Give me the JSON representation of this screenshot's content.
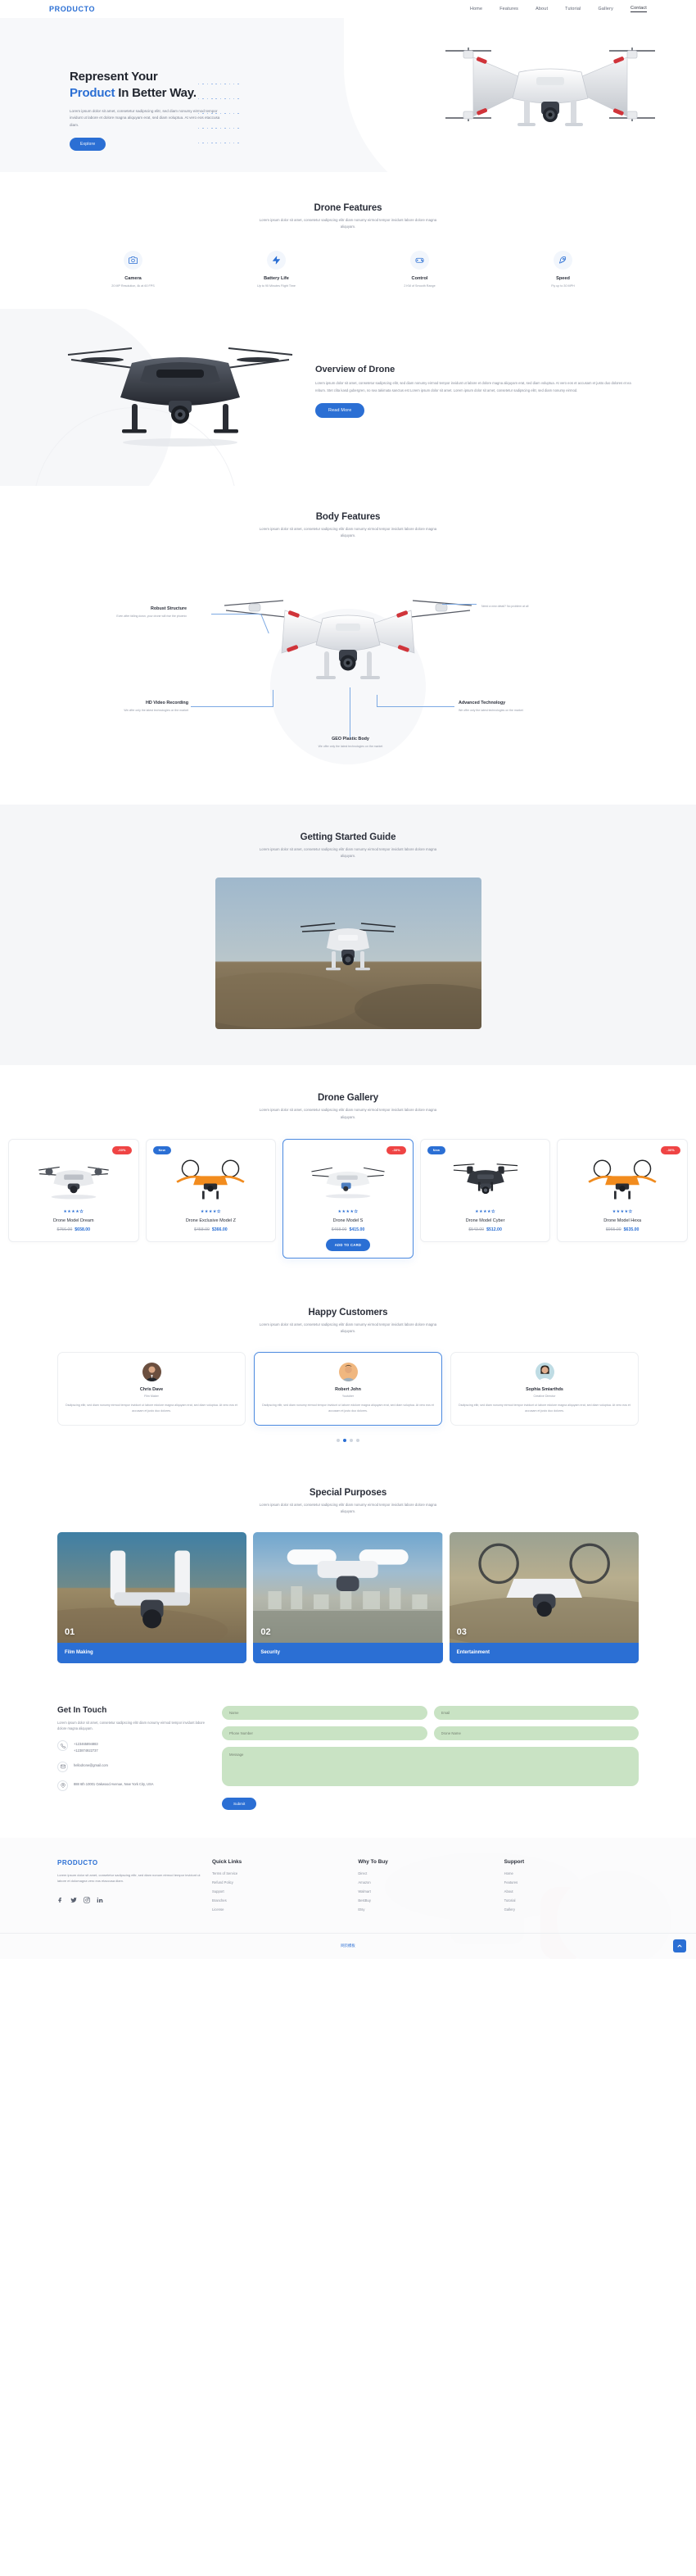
{
  "nav": {
    "brand": "PRODUCTO",
    "links": [
      {
        "label": "Home",
        "active": false
      },
      {
        "label": "Features",
        "active": false
      },
      {
        "label": "About",
        "active": false
      },
      {
        "label": "Tutorial",
        "active": false
      },
      {
        "label": "Gallery",
        "active": false
      },
      {
        "label": "Contact",
        "active": true
      }
    ]
  },
  "hero": {
    "title_line1": "Represent Your",
    "title_accent": "Product",
    "title_rest": " In Better Way.",
    "paragraph": "Lorem ipsum dolor sit amet, consetetur sadipscing elitr, sed diam nonumy eirmod tempor invidunt ut labore et dolore magna aliquyam erat, sed diam voluptua. At vero eos etaccusa diam.",
    "cta": "Explore"
  },
  "features": {
    "title": "Drone Features",
    "subtitle": "Lorem ipsum dolor sit amet, consetetur sadipscing elitr diam nonumy eirmod tempor invidunt labore dolore magna aliquyam.",
    "items": [
      {
        "icon": "camera-icon",
        "title": "Camera",
        "desc": "20 MP Resolution, 4k at 60 FPS"
      },
      {
        "icon": "battery-bolt-icon",
        "title": "Battery Life",
        "desc": "Up to 90 Minutes Flight Time"
      },
      {
        "icon": "gamepad-icon",
        "title": "Control",
        "desc": "2 KM of Smooth Range"
      },
      {
        "icon": "rocket-icon",
        "title": "Speed",
        "desc": "Fly up to 30 MPH"
      }
    ]
  },
  "overview": {
    "title": "Overview of Drone",
    "paragraph": "Lorem ipsum dolor sit amet, consetetur sadipscing elitr, sed diam nonumy eirmod tempor invidunt ut labore et dolore magna aliquyam erat, sed diam voluptua. At vero eos et accusam et justo duo dolores et ea rebum. Stet clita kasd gubergren, no sea takimata sanctus est Lorem ipsum dolor sit amet. Lorem ipsum dolor sit amet, consetetur sadipscing elitr, sed diam nonumy eirmod.",
    "cta": "Read More"
  },
  "body_features": {
    "title": "Body Features",
    "subtitle": "Lorem ipsum dolor sit amet, consetetur sadipscing elitr diam nonumy eirmod tempor invidunt labore dolore magna aliquyam.",
    "annotations": [
      {
        "title": "Robust Structure",
        "desc": "Even after falling down, your drone will rise the phoenix"
      },
      {
        "title": "",
        "desc": "Need a new detail? No problem at all"
      },
      {
        "title": "HD Video Recording",
        "desc": "Get the drone with a spectacular 4k camera"
      },
      {
        "title": "GEO Plastic Body",
        "desc": "We offer only the latest technologies on the market"
      },
      {
        "title": "Advanced Technology",
        "desc": "We offer only the latest technologies on the market"
      }
    ]
  },
  "guide": {
    "title": "Getting Started Guide",
    "subtitle": "Lorem ipsum dolor sit amet, consetetur sadipscing elitr diam nonumy eirmod tempor invidunt labore dolore magna aliquyam."
  },
  "gallery": {
    "title": "Drone Gallery",
    "subtitle": "Lorem ipsum dolor sit amet, consetetur sadipscing elitr diam nonumy eirmod tempor invidunt labore dolore magna aliquyam.",
    "add_to_cart": "ADD TO CARD",
    "products": [
      {
        "name": "Drone Model Dream",
        "old_price": "$756.00",
        "new_price": "$658.00",
        "badge": "-30%",
        "badge_type": "sale",
        "rating": 4,
        "active": false,
        "color": "white"
      },
      {
        "name": "Drone Exclusive Model Z",
        "old_price": "$458.00",
        "new_price": "$366.00",
        "badge": "New",
        "badge_type": "new",
        "rating": 4,
        "active": false,
        "color": "orange"
      },
      {
        "name": "Drone Model S",
        "old_price": "$458.00",
        "new_price": "$415.00",
        "badge": "-30%",
        "badge_type": "sale",
        "rating": 4,
        "active": true,
        "color": "white"
      },
      {
        "name": "Drone Model Cyber",
        "old_price": "$543.00",
        "new_price": "$512.00",
        "badge": "New",
        "badge_type": "new",
        "rating": 4,
        "active": false,
        "color": "black"
      },
      {
        "name": "Drone Model Hexa",
        "old_price": "$965.00",
        "new_price": "$635.00",
        "badge": "-30%",
        "badge_type": "sale",
        "rating": 4,
        "active": false,
        "color": "orange"
      }
    ]
  },
  "testimonials": {
    "title": "Happy Customers",
    "subtitle": "Lorem ipsum dolor sit amet, consetetur sadipscing elitr diam nonumy eirmod tempor invidunt labore dolore magna aliquyam.",
    "items": [
      {
        "name": "Chris Dave",
        "role": "Film Maker",
        "quote": "Dsdipscing elitr, sed diam nonumy eirmod tempor invidunt ut labore edolore magna aliquyam erat, sed diam voluptua. At vero eos et accusam et justo duo dolores.",
        "active": false
      },
      {
        "name": "Robert John",
        "role": "Youtuber",
        "quote": "Dsdipscing elitr, sed diam nonumy eirmod tempor invidunt ut labore edolore magna aliquyam erat, sed diam voluptua. At vero eos et accusam et justo duo dolores.",
        "active": true
      },
      {
        "name": "Sophia Smiarthds",
        "role": "Creative Director",
        "quote": "Dsdipscing elitr, sed diam nonumy eirmod tempor invidunt ut labore edolore magna aliquyam erat, sed diam voluptua. At vero eos et accusam et justo duo dolores.",
        "active": false
      }
    ],
    "dots": [
      false,
      true,
      false,
      false
    ]
  },
  "purposes": {
    "title": "Special Purposes",
    "subtitle": "Lorem ipsum dolor sit amet, consetetur sadipscing elitr diam nonumy eirmod tempor invidunt labore dolore magna aliquyam.",
    "items": [
      {
        "number": "01",
        "label": "Film Making"
      },
      {
        "number": "02",
        "label": "Security"
      },
      {
        "number": "03",
        "label": "Entertainment"
      }
    ]
  },
  "contact": {
    "title": "Get In Touch",
    "paragraph": "Lorem ipsum dolor sit amet, consetetur sadipscing elitr diam nonumy eirmod tempor invidunt labore dolore magna aliquyam.",
    "phone_line1": "+123465894883",
    "phone_line2": "+123874922737",
    "email": "hellodrone@gmail.com",
    "address": "888 6th 10001 Oakwood Avenue, New York City, USA",
    "fields": {
      "name": "Name",
      "email": "Email",
      "phone": "Phone Number",
      "drone": "Drone Name",
      "message": "Message"
    },
    "submit": "Submit"
  },
  "footer": {
    "brand": "PRODUCTO",
    "about": "Lorem ipsum dolor sit amet, consetetur sadipscing elitr, sed diam nonum eirmod tempor invidunt ut labore et dolomagna vero eos etaccusa diam.",
    "socials": [
      "facebook-icon",
      "twitter-icon",
      "instagram-icon",
      "linkedin-icon"
    ],
    "columns": [
      {
        "title": "Quick Links",
        "links": [
          "Terms of Service",
          "Refund Policy",
          "Support",
          "Branches",
          "License"
        ]
      },
      {
        "title": "Why To Buy",
        "links": [
          "Direct",
          "Amazon",
          "Walmart",
          "BestBuy",
          "Etsy"
        ]
      },
      {
        "title": "Support",
        "links": [
          "Home",
          "Features",
          "About",
          "Tutorial",
          "Gallery"
        ]
      }
    ],
    "bottom_link": "网页模板"
  }
}
